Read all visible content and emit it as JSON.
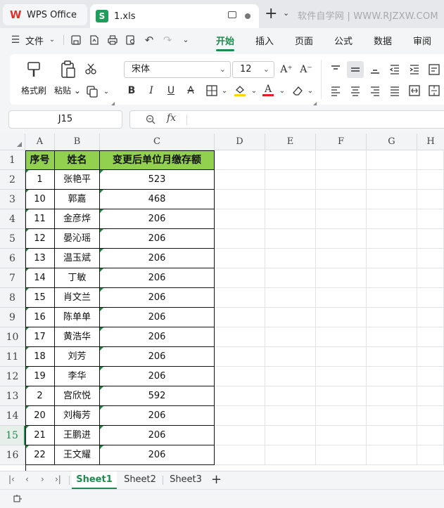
{
  "titlebar": {
    "app_tab": "WPS Office",
    "file_tab": "1.xls",
    "watermark": "软件自学网 | WWW.RJZXW.COM"
  },
  "menubar": {
    "file_label": "文件",
    "tabs": [
      "开始",
      "插入",
      "页面",
      "公式",
      "数据",
      "审阅"
    ],
    "active_tab": "开始"
  },
  "ribbon": {
    "format_painter": "格式刷",
    "paste": "粘贴",
    "font_name": "宋体",
    "font_size": "12",
    "bold": "B",
    "italic": "I",
    "underline": "U",
    "strike": "A"
  },
  "formula_bar": {
    "cell_ref": "J15",
    "fx": "fx"
  },
  "grid": {
    "columns": [
      "A",
      "B",
      "C",
      "D",
      "E",
      "F",
      "G",
      "H"
    ],
    "rows": [
      "1",
      "2",
      "3",
      "4",
      "5",
      "6",
      "7",
      "8",
      "9",
      "10",
      "11",
      "12",
      "13",
      "14",
      "15",
      "16"
    ],
    "active_row": "15",
    "header": [
      "序号",
      "姓名",
      "变更后单位月缴存额"
    ],
    "data": [
      [
        "1",
        "张艳平",
        "523"
      ],
      [
        "10",
        "郭嘉",
        "468"
      ],
      [
        "11",
        "金彦烨",
        "206"
      ],
      [
        "12",
        "晏沁瑶",
        "206"
      ],
      [
        "13",
        "温玉斌",
        "206"
      ],
      [
        "14",
        "丁敏",
        "206"
      ],
      [
        "15",
        "肖文兰",
        "206"
      ],
      [
        "16",
        "陈单单",
        "206"
      ],
      [
        "17",
        "黄浩华",
        "206"
      ],
      [
        "18",
        "刘芳",
        "206"
      ],
      [
        "19",
        "李华",
        "206"
      ],
      [
        "2",
        "宫欣悦",
        "592"
      ],
      [
        "20",
        "刘梅芳",
        "206"
      ],
      [
        "21",
        "王鹏进",
        "206"
      ],
      [
        "22",
        "王文耀",
        "206"
      ]
    ],
    "header_color": "#92d050"
  },
  "sheets": {
    "tabs": [
      "Sheet1",
      "Sheet2",
      "Sheet3"
    ],
    "active": "Sheet1",
    "add": "+"
  },
  "colors": {
    "accent": "#1e8c4e",
    "wps_red": "#e0312d",
    "sheet_icon": "#1e9e5a"
  }
}
